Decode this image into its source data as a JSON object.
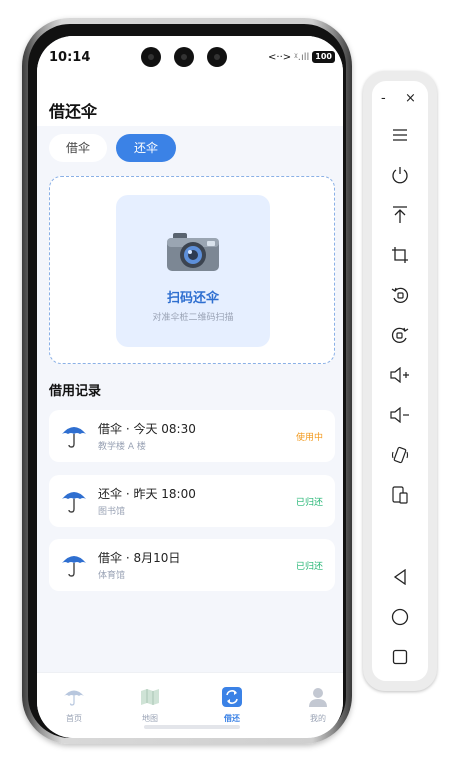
{
  "status_bar": {
    "time": "10:14",
    "network": "<··>",
    "signal": "ᵡ.ıll",
    "battery": "100"
  },
  "page": {
    "title": "借还伞"
  },
  "segment": {
    "borrow_label": "借伞",
    "return_label": "还伞",
    "selected": "还伞"
  },
  "scan": {
    "title": "扫码还伞",
    "subtitle": "对准伞桩二维码扫描"
  },
  "records": {
    "title": "借用记录",
    "items": [
      {
        "title": "借伞 · 今天 08:30",
        "location": "教学楼 A 楼",
        "status": "使用中",
        "status_color": "#f29a1f"
      },
      {
        "title": "还伞 · 昨天 18:00",
        "location": "图书馆",
        "status": "已归还",
        "status_color": "#22b573"
      },
      {
        "title": "借伞 · 8月10日",
        "location": "体育馆",
        "status": "已归还",
        "status_color": "#22b573"
      }
    ]
  },
  "bottom_nav": {
    "items": [
      {
        "label": "首页",
        "icon": "umbrella-icon"
      },
      {
        "label": "地图",
        "icon": "map-icon"
      },
      {
        "label": "借还",
        "icon": "exchange-icon"
      },
      {
        "label": "我的",
        "icon": "user-icon"
      }
    ],
    "active": "借还"
  },
  "emulator_panel": {
    "minimize": "-",
    "close": "×",
    "buttons": [
      "menu-icon",
      "power-icon",
      "upload-icon",
      "crop-icon",
      "rotate-left-icon",
      "rotate-right-icon",
      "volume-up-icon",
      "volume-down-icon",
      "shake-icon",
      "screenshot-icon",
      "back-icon",
      "home-icon",
      "recent-apps-icon"
    ]
  },
  "colors": {
    "accent": "#3b82e6",
    "using": "#f29a1f",
    "returned": "#22b573"
  }
}
